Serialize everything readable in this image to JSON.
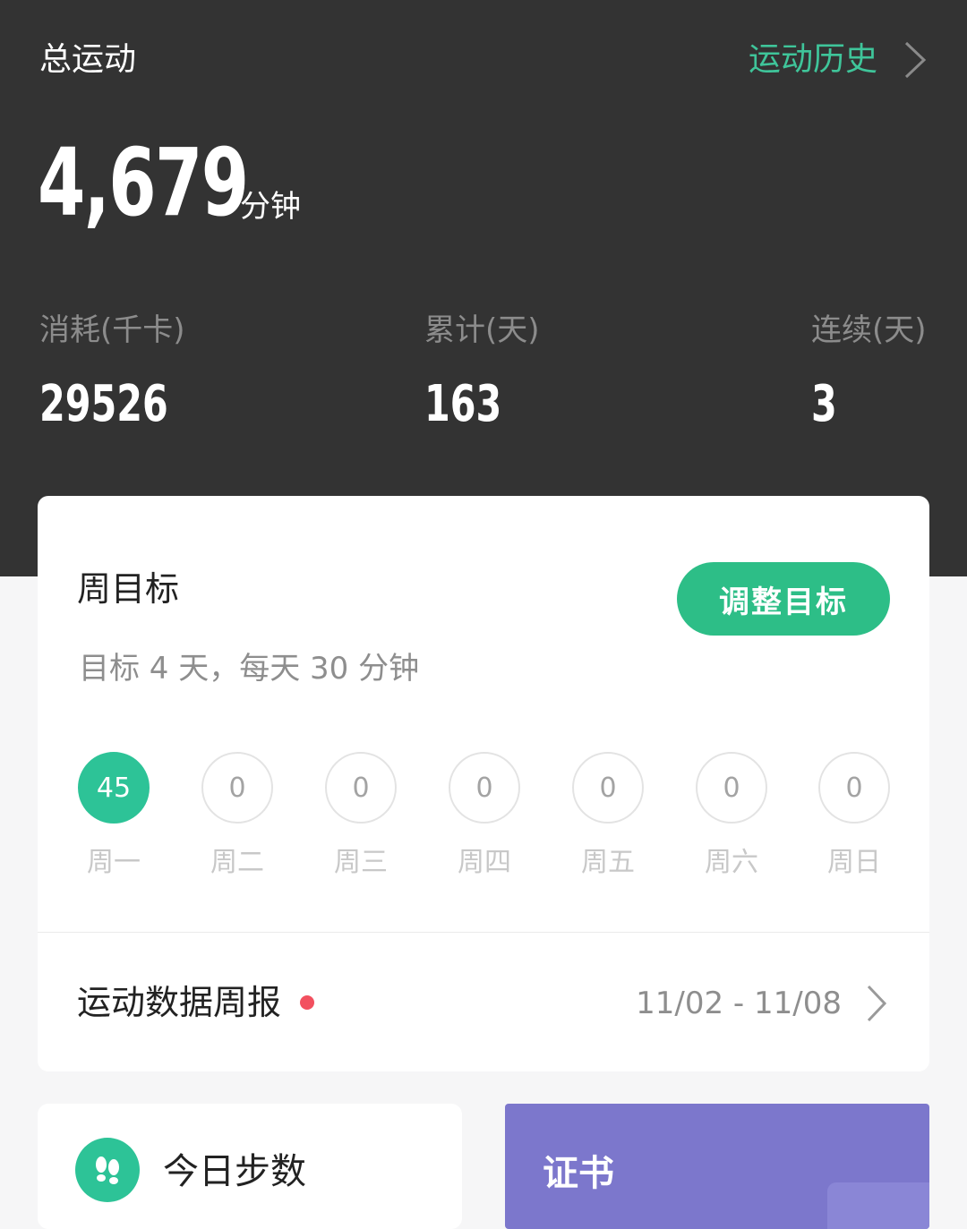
{
  "header": {
    "title": "总运动",
    "history_label": "运动历史"
  },
  "total": {
    "value": "4,679",
    "unit": "分钟"
  },
  "stats": [
    {
      "label": "消耗(千卡)",
      "value": "29526"
    },
    {
      "label": "累计(天)",
      "value": "163"
    },
    {
      "label": "连续(天)",
      "value": "3"
    }
  ],
  "weekly_goal": {
    "title": "周目标",
    "subtitle": "目标 4 天，每天 30 分钟",
    "adjust_button": "调整目标",
    "days": [
      {
        "label": "周一",
        "minutes": "45",
        "active": true
      },
      {
        "label": "周二",
        "minutes": "0",
        "active": false
      },
      {
        "label": "周三",
        "minutes": "0",
        "active": false
      },
      {
        "label": "周四",
        "minutes": "0",
        "active": false
      },
      {
        "label": "周五",
        "minutes": "0",
        "active": false
      },
      {
        "label": "周六",
        "minutes": "0",
        "active": false
      },
      {
        "label": "周日",
        "minutes": "0",
        "active": false
      }
    ]
  },
  "report": {
    "title": "运动数据周报",
    "range": "11/02 - 11/08"
  },
  "steps_card": {
    "label": "今日步数"
  },
  "cert_card": {
    "label": "证书"
  },
  "colors": {
    "accent_green": "#2dbe87",
    "history_green": "#3fc59a",
    "dark_bg": "#333333",
    "cert_purple": "#7c77cc",
    "dot_red": "#f2505f"
  }
}
